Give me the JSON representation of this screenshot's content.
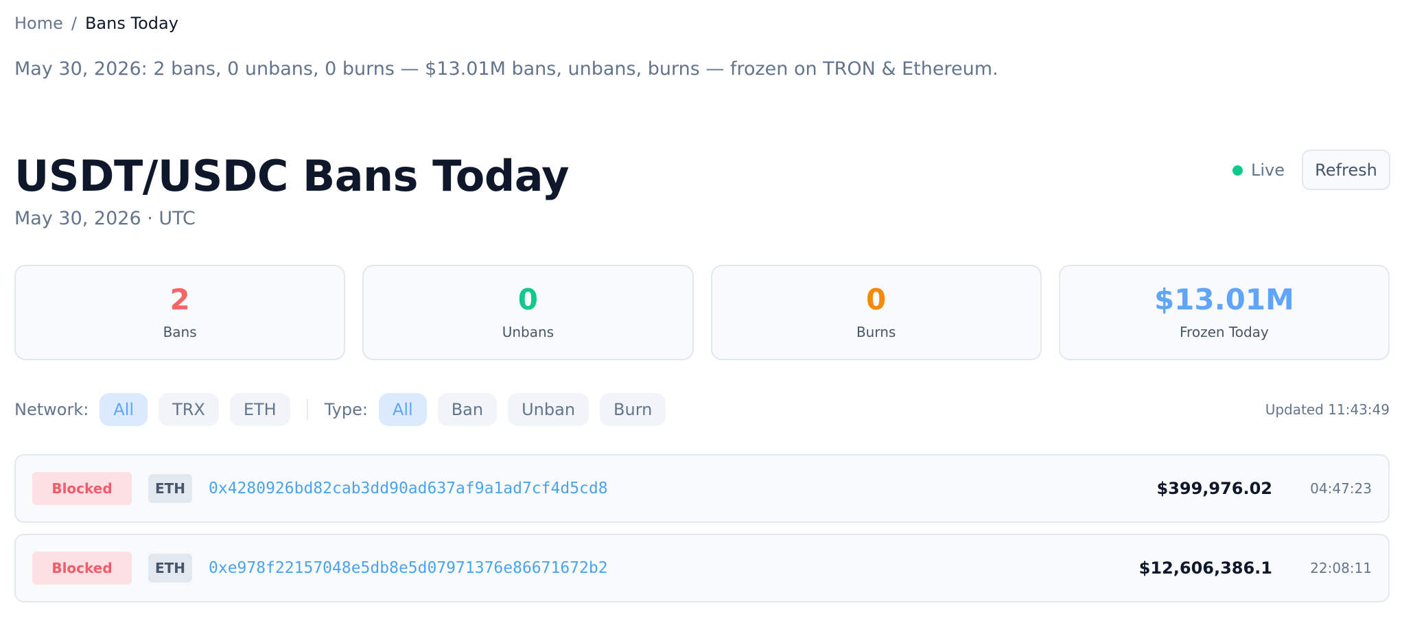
{
  "breadcrumb": {
    "home": "Home",
    "separator": "/",
    "current": "Bans Today"
  },
  "summary": "May 30, 2026: 2 bans, 0 unbans, 0 burns — $13.01M bans, unbans, burns — frozen on TRON & Ethereum.",
  "header": {
    "title": "USDT/USDC Bans Today",
    "subtitle": "May 30, 2026 · UTC",
    "live_label": "Live",
    "refresh_label": "Refresh"
  },
  "stats": [
    {
      "value": "2",
      "label": "Bans",
      "color": "#f56565"
    },
    {
      "value": "0",
      "label": "Unbans",
      "color": "#10c98a"
    },
    {
      "value": "0",
      "label": "Burns",
      "color": "#f5890a"
    },
    {
      "value": "$13.01M",
      "label": "Frozen Today",
      "color": "#60a5fa"
    }
  ],
  "filters": {
    "network_label": "Network:",
    "network_options": [
      "All",
      "TRX",
      "ETH"
    ],
    "type_label": "Type:",
    "type_options": [
      "All",
      "Ban",
      "Unban",
      "Burn"
    ],
    "updated": "Updated 11:43:49"
  },
  "rows": [
    {
      "status": "Blocked",
      "network": "ETH",
      "address": "0x4280926bd82cab3dd90ad637af9a1ad7cf4d5cd8",
      "amount": "$399,976.02",
      "time": "04:47:23"
    },
    {
      "status": "Blocked",
      "network": "ETH",
      "address": "0xe978f22157048e5db8e5d07971376e86671672b2",
      "amount": "$12,606,386.1",
      "time": "22:08:11"
    }
  ]
}
